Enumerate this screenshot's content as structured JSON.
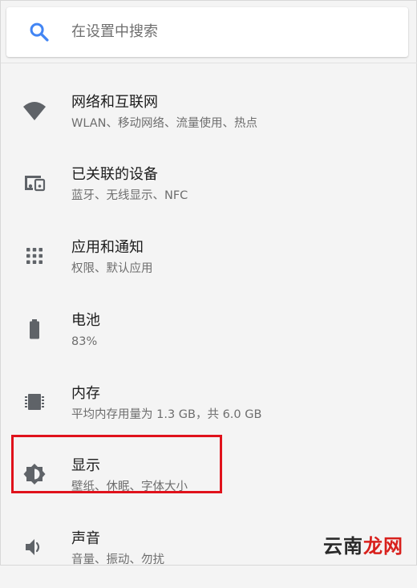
{
  "search": {
    "placeholder": "在设置中搜索"
  },
  "settings_items": [
    {
      "title": "网络和互联网",
      "subtitle": "WLAN、移动网络、流量使用、热点",
      "icon": "wifi-icon"
    },
    {
      "title": "已关联的设备",
      "subtitle": "蓝牙、无线显示、NFC",
      "icon": "devices-icon"
    },
    {
      "title": "应用和通知",
      "subtitle": "权限、默认应用",
      "icon": "apps-icon"
    },
    {
      "title": "电池",
      "subtitle": "83%",
      "icon": "battery-icon"
    },
    {
      "title": "内存",
      "subtitle": "平均内存用量为 1.3 GB，共 6.0 GB",
      "icon": "memory-icon"
    },
    {
      "title": "显示",
      "subtitle": "壁纸、休眠、字体大小",
      "icon": "brightness-icon"
    },
    {
      "title": "声音",
      "subtitle": "音量、振动、勿扰",
      "icon": "volume-icon"
    }
  ],
  "highlight": {
    "target": "显示",
    "color": "#e0121b"
  },
  "watermark": {
    "part1": "云南",
    "part2": "龙网"
  },
  "colors": {
    "search_icon": "#4285f4",
    "icon": "#5f6368",
    "title": "#1c1c1c",
    "subtitle": "#6e6e6e"
  }
}
